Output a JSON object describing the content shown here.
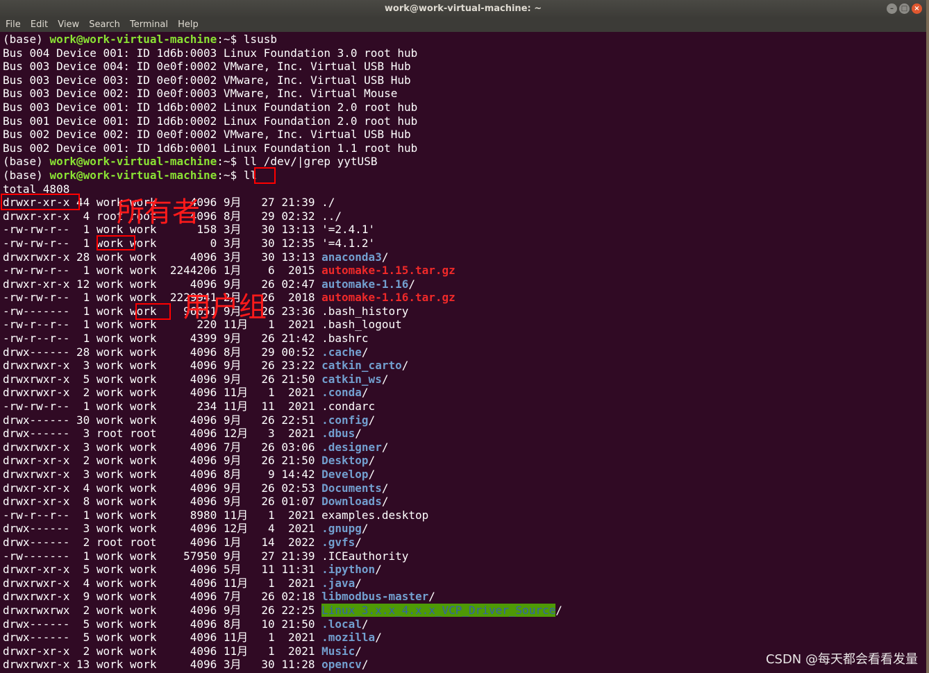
{
  "window": {
    "title": "work@work-virtual-machine: ~"
  },
  "menu": [
    "File",
    "Edit",
    "View",
    "Search",
    "Terminal",
    "Help"
  ],
  "prompt": {
    "env": "(base) ",
    "user": "work@work-virtual-machine",
    "suffix": ":~$ "
  },
  "commands": [
    "lsusb",
    "ll /dev/|grep yytUSB",
    "ll"
  ],
  "lsusb": [
    "Bus 004 Device 001: ID 1d6b:0003 Linux Foundation 3.0 root hub",
    "Bus 003 Device 004: ID 0e0f:0002 VMware, Inc. Virtual USB Hub",
    "Bus 003 Device 003: ID 0e0f:0002 VMware, Inc. Virtual USB Hub",
    "Bus 003 Device 002: ID 0e0f:0003 VMware, Inc. Virtual Mouse",
    "Bus 003 Device 001: ID 1d6b:0002 Linux Foundation 2.0 root hub",
    "Bus 001 Device 001: ID 1d6b:0002 Linux Foundation 2.0 root hub",
    "Bus 002 Device 002: ID 0e0f:0002 VMware, Inc. Virtual USB Hub",
    "Bus 002 Device 001: ID 1d6b:0001 Linux Foundation 1.1 root hub"
  ],
  "total": "total 4808",
  "listing": [
    {
      "p": "drwxr-xr-x 44 work work     4096 9月   27 21:39 ",
      "n": "./",
      "t": "plain"
    },
    {
      "p": "drwxr-xr-x  4 root root     4096 8月   29 02:32 ",
      "n": "../",
      "t": "plain"
    },
    {
      "p": "-rw-rw-r--  1 work work      158 3月   30 13:13 ",
      "n": "'=2.4.1'",
      "t": "plain"
    },
    {
      "p": "-rw-rw-r--  1 work work        0 3月   30 12:35 ",
      "n": "'=4.1.2'",
      "t": "plain"
    },
    {
      "p": "drwxrwxr-x 28 work work     4096 3月   30 13:13 ",
      "n": "anaconda3",
      "t": "dir"
    },
    {
      "p": "-rw-rw-r--  1 work work  2244206 1月    6  2015 ",
      "n": "automake-1.15.tar.gz",
      "t": "arc"
    },
    {
      "p": "drwxr-xr-x 12 work work     4096 9月   26 02:47 ",
      "n": "automake-1.16",
      "t": "dir"
    },
    {
      "p": "-rw-rw-r--  1 work work  2229941 2月   26  2018 ",
      "n": "automake-1.16.tar.gz",
      "t": "arc"
    },
    {
      "p": "-rw-------  1 work work    96051 9月   26 23:36 ",
      "n": ".bash_history",
      "t": "plain"
    },
    {
      "p": "-rw-r--r--  1 work work      220 11月   1  2021 ",
      "n": ".bash_logout",
      "t": "plain"
    },
    {
      "p": "-rw-r--r--  1 work work     4399 9月   26 21:42 ",
      "n": ".bashrc",
      "t": "plain"
    },
    {
      "p": "drwx------ 28 work work     4096 8月   29 00:52 ",
      "n": ".cache",
      "t": "dir"
    },
    {
      "p": "drwxrwxr-x  3 work work     4096 9月   26 23:22 ",
      "n": "catkin_carto",
      "t": "dir"
    },
    {
      "p": "drwxrwxr-x  5 work work     4096 9月   26 21:50 ",
      "n": "catkin_ws",
      "t": "dir"
    },
    {
      "p": "drwxrwxr-x  2 work work     4096 11月   1  2021 ",
      "n": ".conda",
      "t": "dir"
    },
    {
      "p": "-rw-rw-r--  1 work work      234 11月  11  2021 ",
      "n": ".condarc",
      "t": "plain"
    },
    {
      "p": "drwx------ 30 work work     4096 9月   26 22:51 ",
      "n": ".config",
      "t": "dir"
    },
    {
      "p": "drwx------  3 root root     4096 12月   3  2021 ",
      "n": ".dbus",
      "t": "dir"
    },
    {
      "p": "drwxrwxr-x  3 work work     4096 7月   26 03:06 ",
      "n": ".designer",
      "t": "dir"
    },
    {
      "p": "drwxr-xr-x  2 work work     4096 9月   26 21:50 ",
      "n": "Desktop",
      "t": "dir"
    },
    {
      "p": "drwxrwxr-x  3 work work     4096 8月    9 14:42 ",
      "n": "Develop",
      "t": "dir"
    },
    {
      "p": "drwxr-xr-x  4 work work     4096 9月   26 02:53 ",
      "n": "Documents",
      "t": "dir"
    },
    {
      "p": "drwxr-xr-x  8 work work     4096 9月   26 01:07 ",
      "n": "Downloads",
      "t": "dir"
    },
    {
      "p": "-rw-r--r--  1 work work     8980 11月   1  2021 ",
      "n": "examples.desktop",
      "t": "plain"
    },
    {
      "p": "drwx------  3 work work     4096 12月   4  2021 ",
      "n": ".gnupg",
      "t": "dir"
    },
    {
      "p": "drwx------  2 root root     4096 1月   14  2022 ",
      "n": ".gvfs",
      "t": "dir"
    },
    {
      "p": "-rw-------  1 work work    57950 9月   27 21:39 ",
      "n": ".ICEauthority",
      "t": "plain"
    },
    {
      "p": "drwxr-xr-x  5 work work     4096 5月   11 11:31 ",
      "n": ".ipython",
      "t": "dir"
    },
    {
      "p": "drwxrwxr-x  4 work work     4096 11月   1  2021 ",
      "n": ".java",
      "t": "dir"
    },
    {
      "p": "drwxrwxr-x  9 work work     4096 7月   26 02:18 ",
      "n": "libmodbus-master",
      "t": "dir"
    },
    {
      "p": "drwxrwxrwx  2 work work     4096 9月   26 22:25 ",
      "n": "Linux_3.x.x_4.x.x_VCP_Driver_Source",
      "t": "hl"
    },
    {
      "p": "drwx------  5 work work     4096 8月   10 21:50 ",
      "n": ".local",
      "t": "dir"
    },
    {
      "p": "drwx------  5 work work     4096 11月   1  2021 ",
      "n": ".mozilla",
      "t": "dir"
    },
    {
      "p": "drwxr-xr-x  2 work work     4096 11月   1  2021 ",
      "n": "Music",
      "t": "dir"
    },
    {
      "p": "drwxrwxr-x 13 work work     4096 3月   30 11:28 ",
      "n": "opencv",
      "t": "dir"
    }
  ],
  "annotations": {
    "owner": "所有者",
    "group": "用户组"
  },
  "watermark": "CSDN @每天都会看看发量"
}
